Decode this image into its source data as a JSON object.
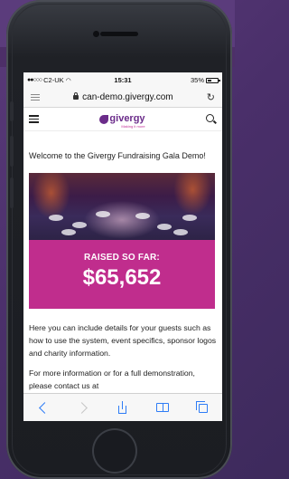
{
  "status_bar": {
    "carrier": "C2-UK",
    "time": "15:31",
    "battery": "35%"
  },
  "browser": {
    "url": "can-demo.givergy.com",
    "reload_icon": "reload-icon",
    "reader_icon": "reader-icon"
  },
  "site": {
    "logo_text": "givergy",
    "logo_tagline": "Making it more",
    "intro": "Welcome to the Givergy Fundraising Gala Demo!",
    "raised_label": "RAISED SO FAR:",
    "raised_amount": "$65,652",
    "paragraph_1": "Here you can include details for your guests such as how to use the system, event specifics, sponsor logos and charity information.",
    "paragraph_2": "For more information or for a full demonstration, please contact us at"
  },
  "toolbar": {
    "icons": [
      "back-icon",
      "forward-icon",
      "share-icon",
      "bookmarks-icon",
      "tabs-icon"
    ]
  },
  "colors": {
    "brand_purple": "#6b2c8a",
    "raised_magenta": "#c02d8d",
    "ios_blue": "#2e7cf6",
    "background_purple": "#4a2f6a"
  }
}
